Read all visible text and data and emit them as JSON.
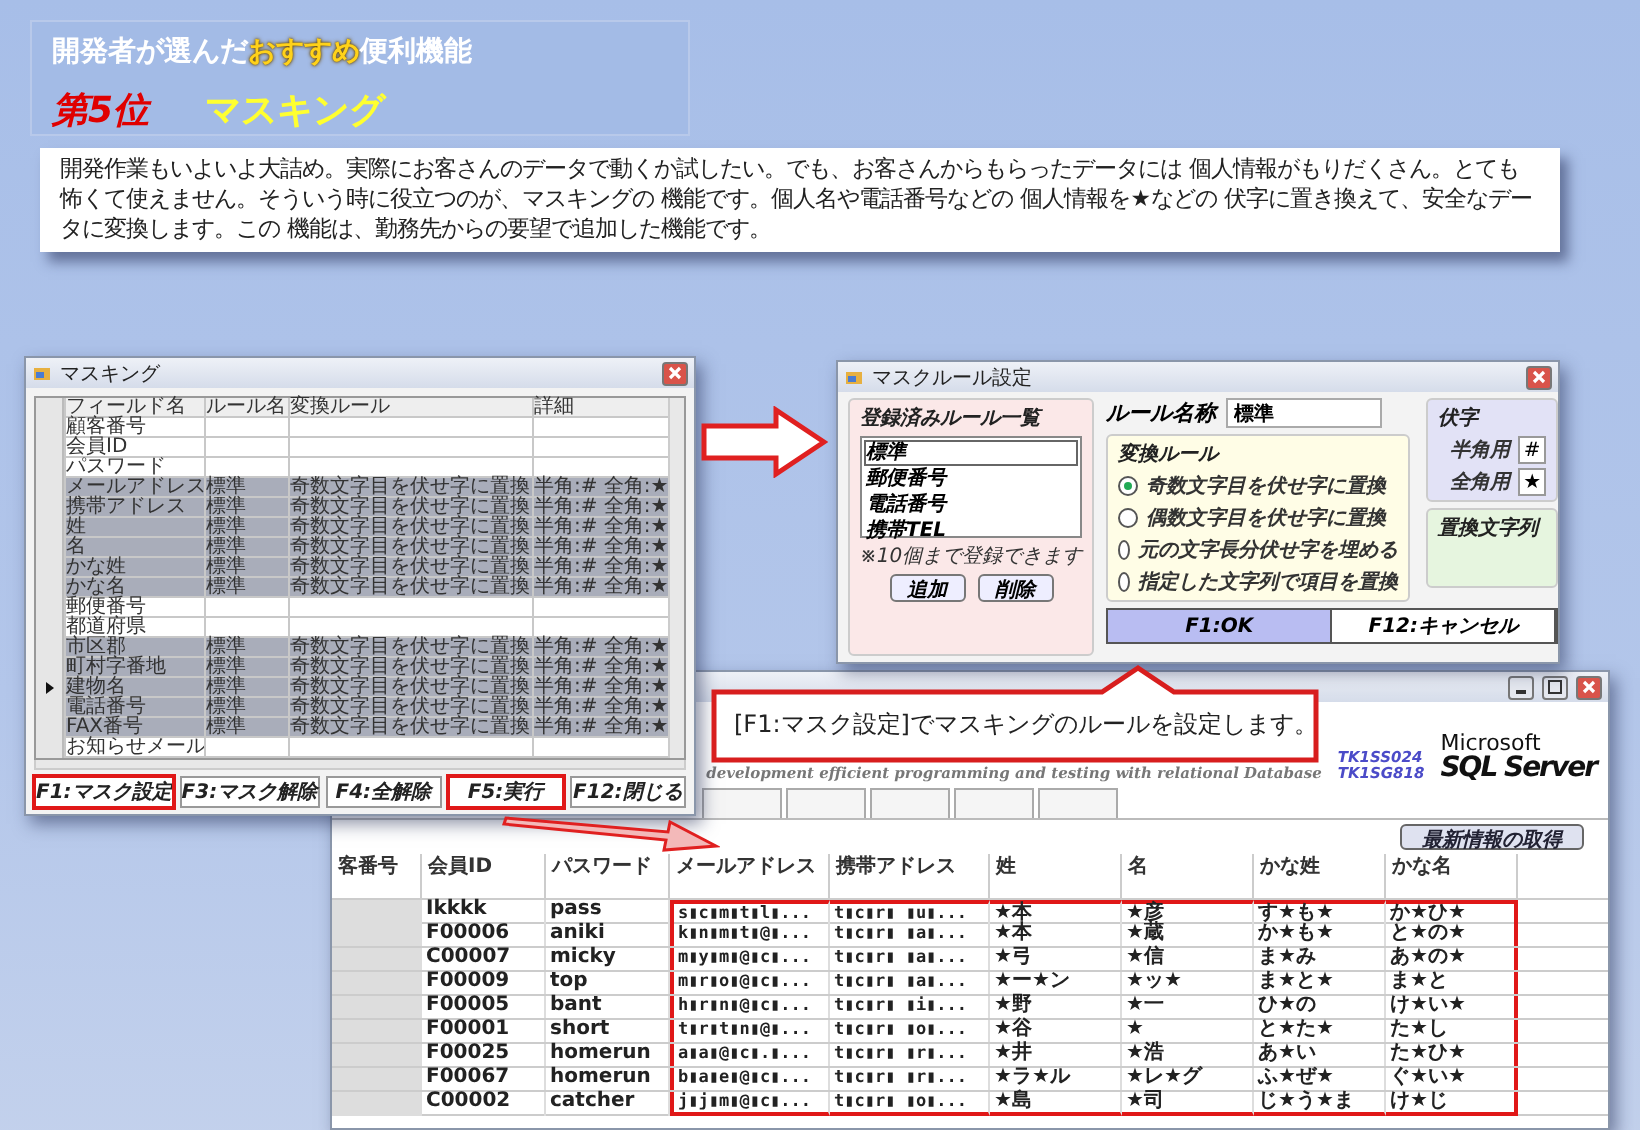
{
  "header": {
    "title_parts": [
      {
        "text": "開発者が選んだ",
        "kind": "normal"
      },
      {
        "text": "おすすめ",
        "kind": "accent"
      },
      {
        "text": "便利機能",
        "kind": "normal"
      }
    ],
    "rank": "第5位",
    "feature": "マスキング"
  },
  "intro": "開発作業もいよいよ大詰め。実際にお客さんのデータで動くか試したい。でも、お客さんからもらったデータには 個人情報がもりだくさん。とても怖くて使えません。そういう時に役立つのが、マスキングの 機能です。個人名や電話番号などの 個人情報を★などの 伏字に置き換えて、安全なデータに変換します。この 機能は、勤務先からの要望で追加した機能です。",
  "masking_window": {
    "title": "マスキング",
    "columns": [
      "フィールド名",
      "ルール名",
      "変換ルール",
      "詳細"
    ],
    "rows": [
      {
        "field": "顧客番号",
        "rule": "",
        "conversion": "",
        "detail": "",
        "masked": false,
        "selected": false
      },
      {
        "field": "会員ID",
        "rule": "",
        "conversion": "",
        "detail": "",
        "masked": false,
        "selected": false
      },
      {
        "field": "パスワード",
        "rule": "",
        "conversion": "",
        "detail": "",
        "masked": false,
        "selected": false
      },
      {
        "field": "メールアドレス",
        "rule": "標準",
        "conversion": "奇数文字目を伏せ字に置換",
        "detail": "半角:# 全角:★",
        "masked": true,
        "selected": false
      },
      {
        "field": "携帯アドレス",
        "rule": "標準",
        "conversion": "奇数文字目を伏せ字に置換",
        "detail": "半角:# 全角:★",
        "masked": true,
        "selected": false
      },
      {
        "field": "姓",
        "rule": "標準",
        "conversion": "奇数文字目を伏せ字に置換",
        "detail": "半角:# 全角:★",
        "masked": true,
        "selected": false
      },
      {
        "field": "名",
        "rule": "標準",
        "conversion": "奇数文字目を伏せ字に置換",
        "detail": "半角:# 全角:★",
        "masked": true,
        "selected": false
      },
      {
        "field": "かな姓",
        "rule": "標準",
        "conversion": "奇数文字目を伏せ字に置換",
        "detail": "半角:# 全角:★",
        "masked": true,
        "selected": false
      },
      {
        "field": "かな名",
        "rule": "標準",
        "conversion": "奇数文字目を伏せ字に置換",
        "detail": "半角:# 全角:★",
        "masked": true,
        "selected": false
      },
      {
        "field": "郵便番号",
        "rule": "",
        "conversion": "",
        "detail": "",
        "masked": false,
        "selected": false
      },
      {
        "field": "都道府県",
        "rule": "",
        "conversion": "",
        "detail": "",
        "masked": false,
        "selected": false
      },
      {
        "field": "市区郡",
        "rule": "標準",
        "conversion": "奇数文字目を伏せ字に置換",
        "detail": "半角:# 全角:★",
        "masked": true,
        "selected": false
      },
      {
        "field": "町村字番地",
        "rule": "標準",
        "conversion": "奇数文字目を伏せ字に置換",
        "detail": "半角:# 全角:★",
        "masked": true,
        "selected": false
      },
      {
        "field": "建物名",
        "rule": "標準",
        "conversion": "奇数文字目を伏せ字に置換",
        "detail": "半角:# 全角:★",
        "masked": true,
        "selected": true
      },
      {
        "field": "電話番号",
        "rule": "標準",
        "conversion": "奇数文字目を伏せ字に置換",
        "detail": "半角:# 全角:★",
        "masked": true,
        "selected": false
      },
      {
        "field": "FAX番号",
        "rule": "標準",
        "conversion": "奇数文字目を伏せ字に置換",
        "detail": "半角:# 全角:★",
        "masked": true,
        "selected": false
      },
      {
        "field": "お知らせメール",
        "rule": "",
        "conversion": "",
        "detail": "",
        "masked": false,
        "selected": false
      }
    ],
    "buttons": [
      {
        "label": "F1:マスク設定",
        "highlighted": true
      },
      {
        "label": "F3:マスク解除",
        "highlighted": false
      },
      {
        "label": "F4:全解除",
        "highlighted": false
      },
      {
        "label": "F5:実行",
        "highlighted": true
      },
      {
        "label": "F12:閉じる",
        "highlighted": false
      }
    ]
  },
  "rule_dialog": {
    "title": "マスクルール設定",
    "list_title": "登録済みルール一覧",
    "rules": [
      {
        "label": "標準",
        "selected": true
      },
      {
        "label": "郵便番号",
        "selected": false
      },
      {
        "label": "電話番号",
        "selected": false
      },
      {
        "label": "携帯TEL",
        "selected": false
      }
    ],
    "note": "※10個まで登録できます",
    "add_button": "追加",
    "delete_button": "削除",
    "name_label": "ルール名称",
    "name_value": "標準",
    "conversion_title": "変換ルール",
    "options": [
      {
        "label": "奇数文字目を伏せ字に置換",
        "selected": true
      },
      {
        "label": "偶数文字目を伏せ字に置換",
        "selected": false
      },
      {
        "label": "元の文字長分伏せ字を埋める",
        "selected": false
      },
      {
        "label": "指定した文字列で項目を置換",
        "selected": false
      }
    ],
    "mask_title": "伏字",
    "mask_chars": [
      {
        "label": "半角用",
        "value": "#"
      },
      {
        "label": "全角用",
        "value": "★"
      }
    ],
    "replace_title": "置換文字列",
    "buttons": [
      {
        "label": "F1:OK",
        "default": true
      },
      {
        "label": "F12:キャンセル",
        "default": false
      }
    ]
  },
  "callout": "[F1:マスク設定]でマスキングのルールを設定します。",
  "data_window": {
    "subtitle": "development efficient programming and testing with relational Database",
    "codes": [
      "TK1SS024",
      "TK1SG818"
    ],
    "logo_top": "Microsoft",
    "logo_bottom": "SQL Server",
    "refresh_button": "最新情報の取得",
    "columns": [
      {
        "label": "客番号",
        "highlighted": false
      },
      {
        "label": "会員ID",
        "highlighted": false
      },
      {
        "label": "パスワード",
        "highlighted": false
      },
      {
        "label": "メールアドレス",
        "highlighted": true
      },
      {
        "label": "携帯アドレス",
        "highlighted": true
      },
      {
        "label": "姓",
        "highlighted": true
      },
      {
        "label": "名",
        "highlighted": true
      },
      {
        "label": "かな姓",
        "highlighted": true
      },
      {
        "label": "かな名",
        "highlighted": true
      }
    ],
    "rows": [
      [
        "",
        "Ikkkk",
        "pass",
        "s▮c▮m▮t▮l▮...",
        "t▮c▮r▮ ▮u▮...",
        "★本",
        "★彦",
        "す★も★",
        "か★ひ★"
      ],
      [
        "",
        "F00006",
        "aniki",
        "k▮n▮m▮t▮@▮...",
        "t▮c▮r▮ ▮a▮...",
        "★本",
        "★蔵",
        "か★も★",
        "と★の★"
      ],
      [
        "",
        "C00007",
        "micky",
        "m▮y▮m▮@▮c▮...",
        "t▮c▮r▮ ▮a▮...",
        "★弓",
        "★信",
        "ま★み",
        "あ★の★"
      ],
      [
        "",
        "F00009",
        "top",
        "m▮r▮o▮@▮c▮...",
        "t▮c▮r▮ ▮a▮...",
        "★ー★ン",
        "★ッ★",
        "ま★と★",
        "ま★と"
      ],
      [
        "",
        "F00005",
        "bant",
        "h▮r▮n▮@▮c▮...",
        "t▮c▮r▮ ▮i▮...",
        "★野",
        "★一",
        "ひ★の",
        "け★い★"
      ],
      [
        "",
        "F00001",
        "short",
        "t▮r▮t▮n▮@▮...",
        "t▮c▮r▮ ▮o▮...",
        "★谷",
        "★",
        "と★た★",
        "た★し"
      ],
      [
        "",
        "F00025",
        "homerun",
        "a▮a▮@▮c▮.▮...",
        "t▮c▮r▮ ▮r▮...",
        "★井",
        "★浩",
        "あ★い",
        "た★ひ★"
      ],
      [
        "",
        "F00067",
        "homerun",
        "b▮a▮e▮@▮c▮...",
        "t▮c▮r▮ ▮r▮...",
        "★ラ★ル",
        "★レ★グ",
        "ふ★ぜ★",
        "ぐ★い★"
      ],
      [
        "",
        "C00002",
        "catcher",
        "j▮j▮m▮@▮c▮...",
        "t▮c▮r▮ ▮o▮...",
        "★島",
        "★司",
        "じ★う★ま",
        "け★じ"
      ]
    ]
  }
}
